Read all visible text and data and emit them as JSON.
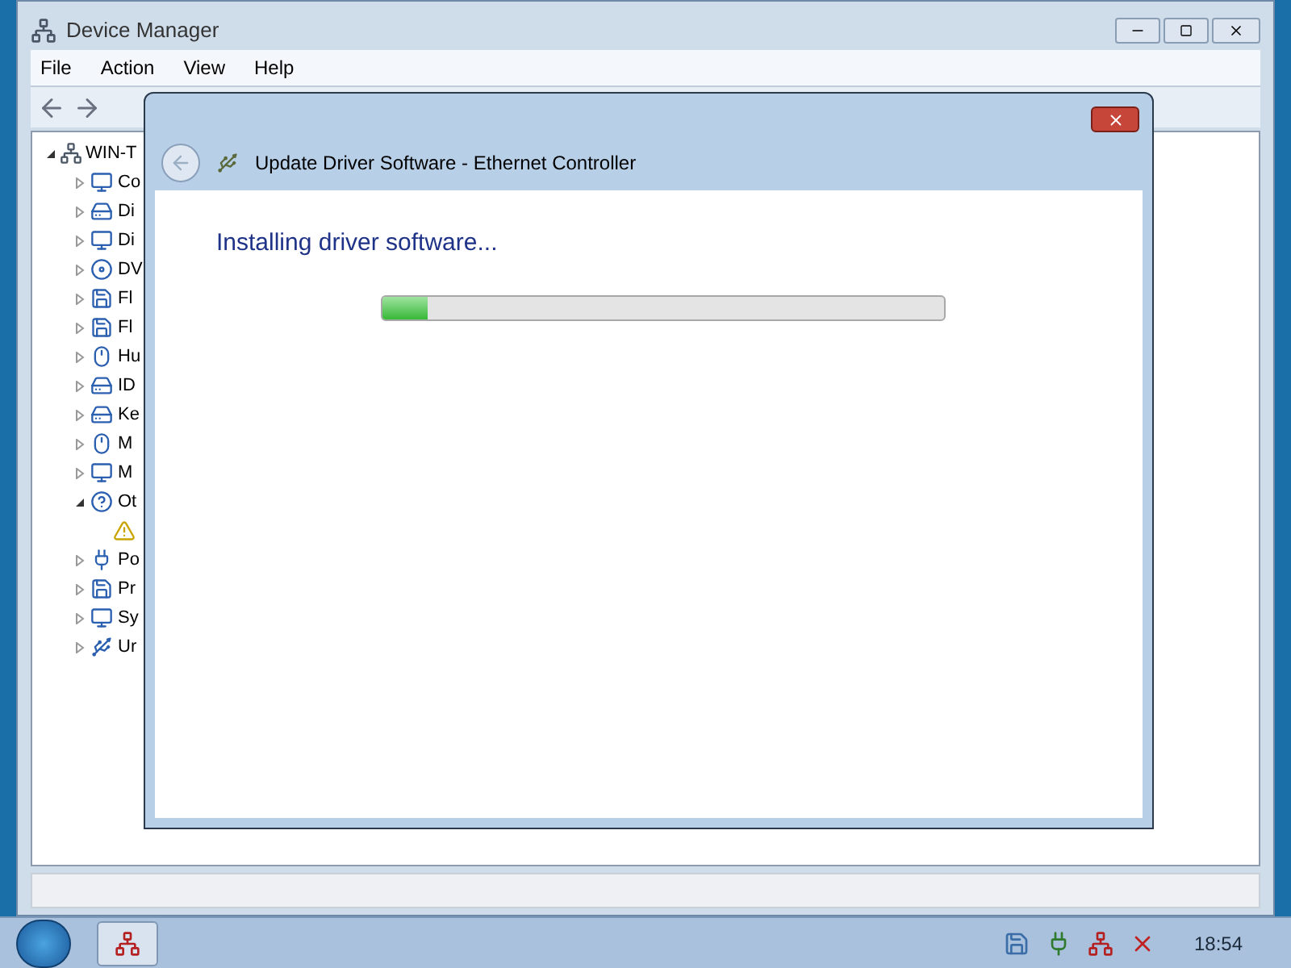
{
  "window": {
    "title": "Device Manager"
  },
  "menu": [
    "File",
    "Action",
    "View",
    "Help"
  ],
  "tree": {
    "label": "WIN-T",
    "expanded": true,
    "children": [
      {
        "label": "Co",
        "expanded": false
      },
      {
        "label": "Di",
        "expanded": false
      },
      {
        "label": "Di",
        "expanded": false
      },
      {
        "label": "DV",
        "expanded": false
      },
      {
        "label": "Fl",
        "expanded": false
      },
      {
        "label": "Fl",
        "expanded": false
      },
      {
        "label": "Hu",
        "expanded": false
      },
      {
        "label": "ID",
        "expanded": false
      },
      {
        "label": "Ke",
        "expanded": false
      },
      {
        "label": "M",
        "expanded": false
      },
      {
        "label": "M",
        "expanded": false
      },
      {
        "label": "Ot",
        "expanded": true,
        "children": [
          {
            "kind": "warning"
          }
        ]
      },
      {
        "label": "Po",
        "expanded": false
      },
      {
        "label": "Pr",
        "expanded": false
      },
      {
        "label": "Sy",
        "expanded": false
      },
      {
        "label": "Ur",
        "expanded": false
      }
    ]
  },
  "dialog": {
    "title": "Update Driver Software - Ethernet Controller",
    "heading": "Installing driver software...",
    "progress": {
      "level": 0.08
    }
  },
  "taskbar": {
    "clock": "18:54"
  }
}
